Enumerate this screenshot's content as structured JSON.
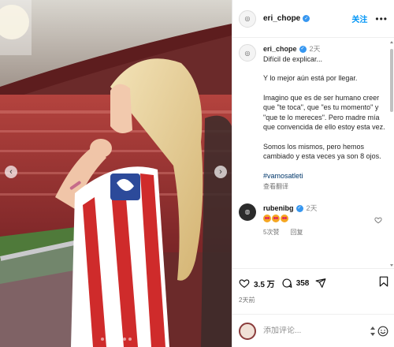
{
  "post": {
    "username": "eri_chope",
    "follow_label": "关注",
    "more_label": "•••"
  },
  "caption": {
    "username": "eri_chope",
    "time": "2天",
    "paragraphs": [
      "Difícil de explicar...",
      "Y lo mejor aún está por llegar.",
      "Imagino que es de ser humano creer que \"te toca\", que \"es tu momento\" y \"que te lo mereces\". Pero madre mía que convencida de ello estoy esta vez.",
      "Somos los mismos, pero hemos cambiado y esta veces ya son 8 ojos."
    ],
    "hashtag": "#vamosatleti",
    "translate_label": "查看翻译"
  },
  "comment": {
    "username": "rubenibg",
    "time": "2天",
    "likes_label": "5次赞",
    "reply_label": "回复"
  },
  "actions": {
    "likes_count": "3.5 万",
    "comments_count": "358",
    "posted_time": "2天前"
  },
  "composer": {
    "placeholder": "添加评论..."
  },
  "colors": {
    "accent": "#0095f6",
    "verified": "#3797f0",
    "hashtag": "#00376b"
  },
  "carousel": {
    "slide_count": 6,
    "active_slide": 2
  }
}
